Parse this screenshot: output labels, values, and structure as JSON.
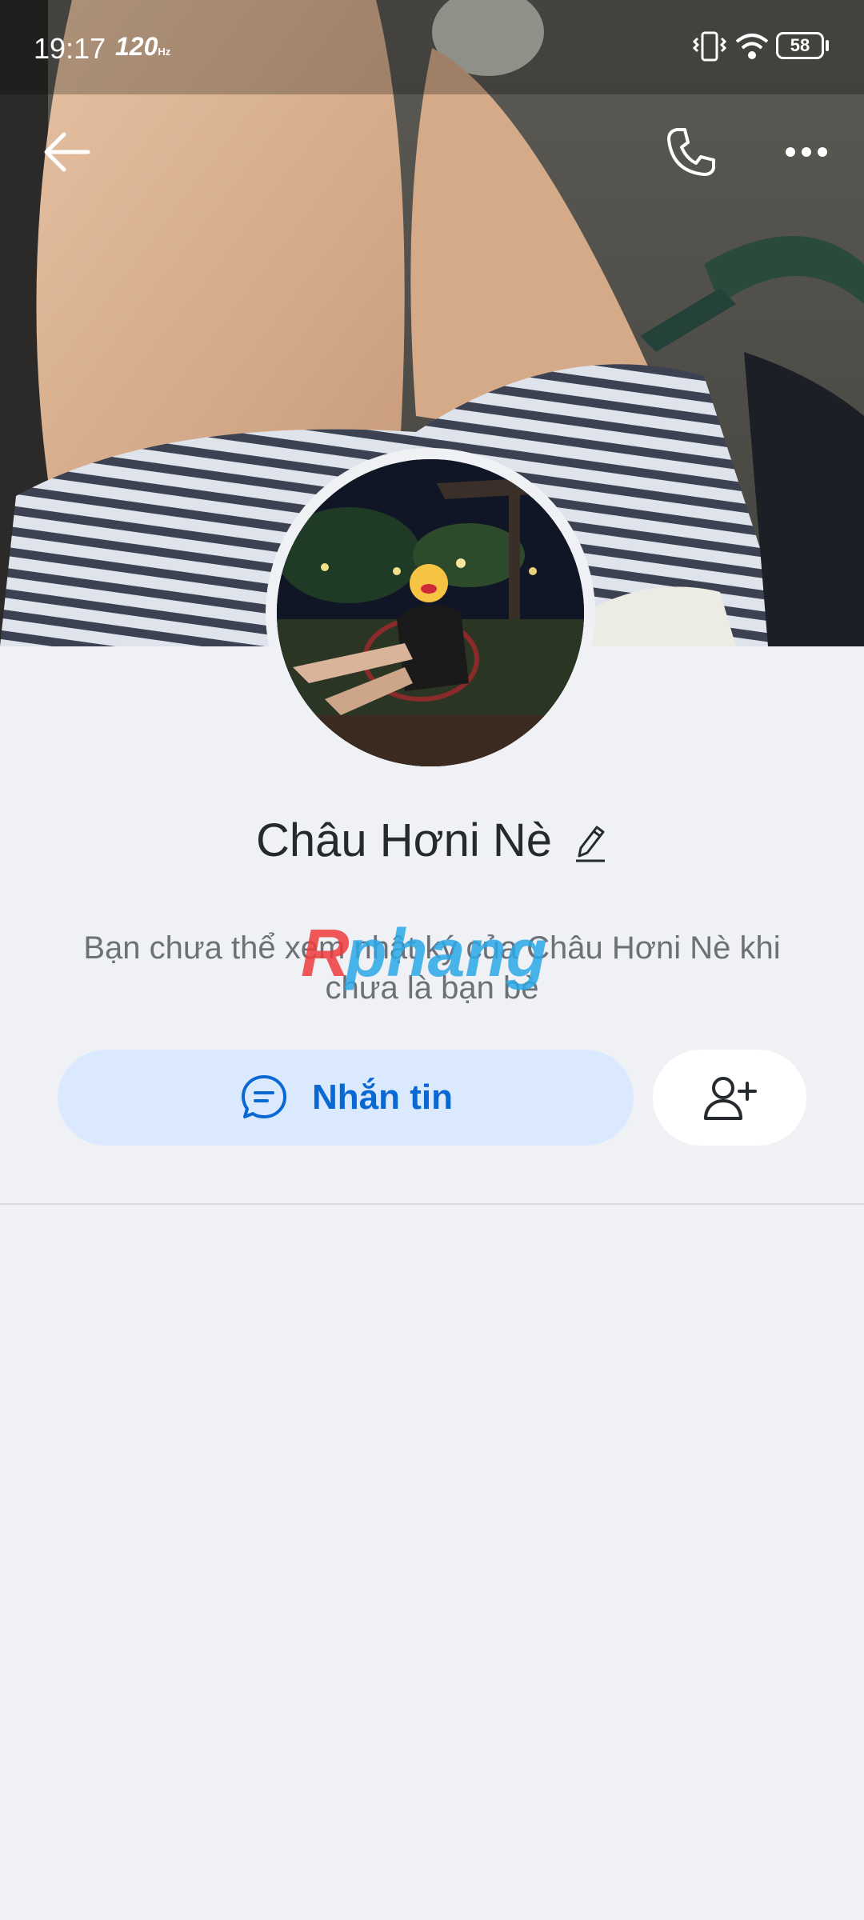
{
  "status_bar": {
    "time": "19:17",
    "refresh_rate": "120",
    "refresh_unit": "Hz",
    "battery": "58"
  },
  "header": {
    "back_icon": "arrow-left-icon",
    "call_icon": "phone-icon",
    "more_icon": "more-dots-icon"
  },
  "profile": {
    "name": "Châu Hơni Nè",
    "notice": "Bạn chưa thể xem nhật ký của Châu Hơni Nè khi chưa là bạn bè"
  },
  "actions": {
    "message_label": "Nhắn tin",
    "message_icon": "chat-bubble-icon",
    "add_friend_icon": "add-friend-icon"
  },
  "watermark": {
    "text": "Rphang"
  },
  "colors": {
    "accent": "#0a68d3",
    "message_button_bg": "#dbe9fe",
    "page_bg": "#f0f1f5"
  }
}
